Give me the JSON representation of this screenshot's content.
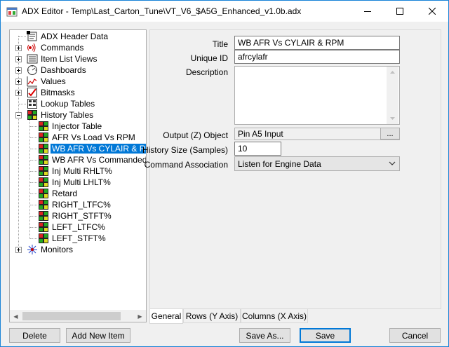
{
  "window": {
    "title": "ADX Editor - Temp\\Last_Carton_Tune\\VT_V6_$A5G_Enhanced_v1.0b.adx",
    "minimize_icon": "minimize-icon",
    "maximize_icon": "maximize-icon",
    "close_icon": "close-icon"
  },
  "tree": {
    "items": [
      {
        "label": "ADX Header Data",
        "icon": "header-data-icon"
      },
      {
        "label": "Commands",
        "icon": "commands-icon"
      },
      {
        "label": "Item List Views",
        "icon": "list-views-icon"
      },
      {
        "label": "Dashboards",
        "icon": "dashboard-icon"
      },
      {
        "label": "Values",
        "icon": "values-icon"
      },
      {
        "label": "Bitmasks",
        "icon": "bitmask-icon"
      },
      {
        "label": "Lookup Tables",
        "icon": "lookup-table-icon"
      },
      {
        "label": "History Tables",
        "icon": "history-table-icon"
      },
      {
        "label": "Monitors",
        "icon": "monitor-icon"
      }
    ],
    "history_children": [
      {
        "label": "Injector Table"
      },
      {
        "label": "AFR Vs Load Vs RPM"
      },
      {
        "label": "WB AFR Vs CYLAIR & RPM"
      },
      {
        "label": "WB AFR Vs Commanded AFR"
      },
      {
        "label": "Inj Multi RHLT%"
      },
      {
        "label": "Inj Multi LHLT%"
      },
      {
        "label": "Retard"
      },
      {
        "label": "RIGHT_LTFC%"
      },
      {
        "label": "RIGHT_STFT%"
      },
      {
        "label": "LEFT_LTFC%"
      },
      {
        "label": "LEFT_STFT%"
      }
    ]
  },
  "props": {
    "title_label": "Title",
    "title_value": "WB AFR Vs CYLAIR & RPM",
    "unique_id_label": "Unique ID",
    "unique_id_value": "afrcylafr",
    "description_label": "Description",
    "description_value": "",
    "output_label": "Output (Z) Object",
    "output_value": "Pin A5 Input",
    "output_browse": "...",
    "history_size_label": "History Size (Samples)",
    "history_size_value": "10",
    "command_assoc_label": "Command Association",
    "command_assoc_value": "Listen for Engine Data"
  },
  "tabs": [
    {
      "label": "General"
    },
    {
      "label": "Rows (Y Axis)"
    },
    {
      "label": "Columns (X Axis)"
    }
  ],
  "buttons": {
    "delete": "Delete",
    "add_new_item": "Add New Item",
    "save_as": "Save As...",
    "save": "Save",
    "cancel": "Cancel"
  }
}
